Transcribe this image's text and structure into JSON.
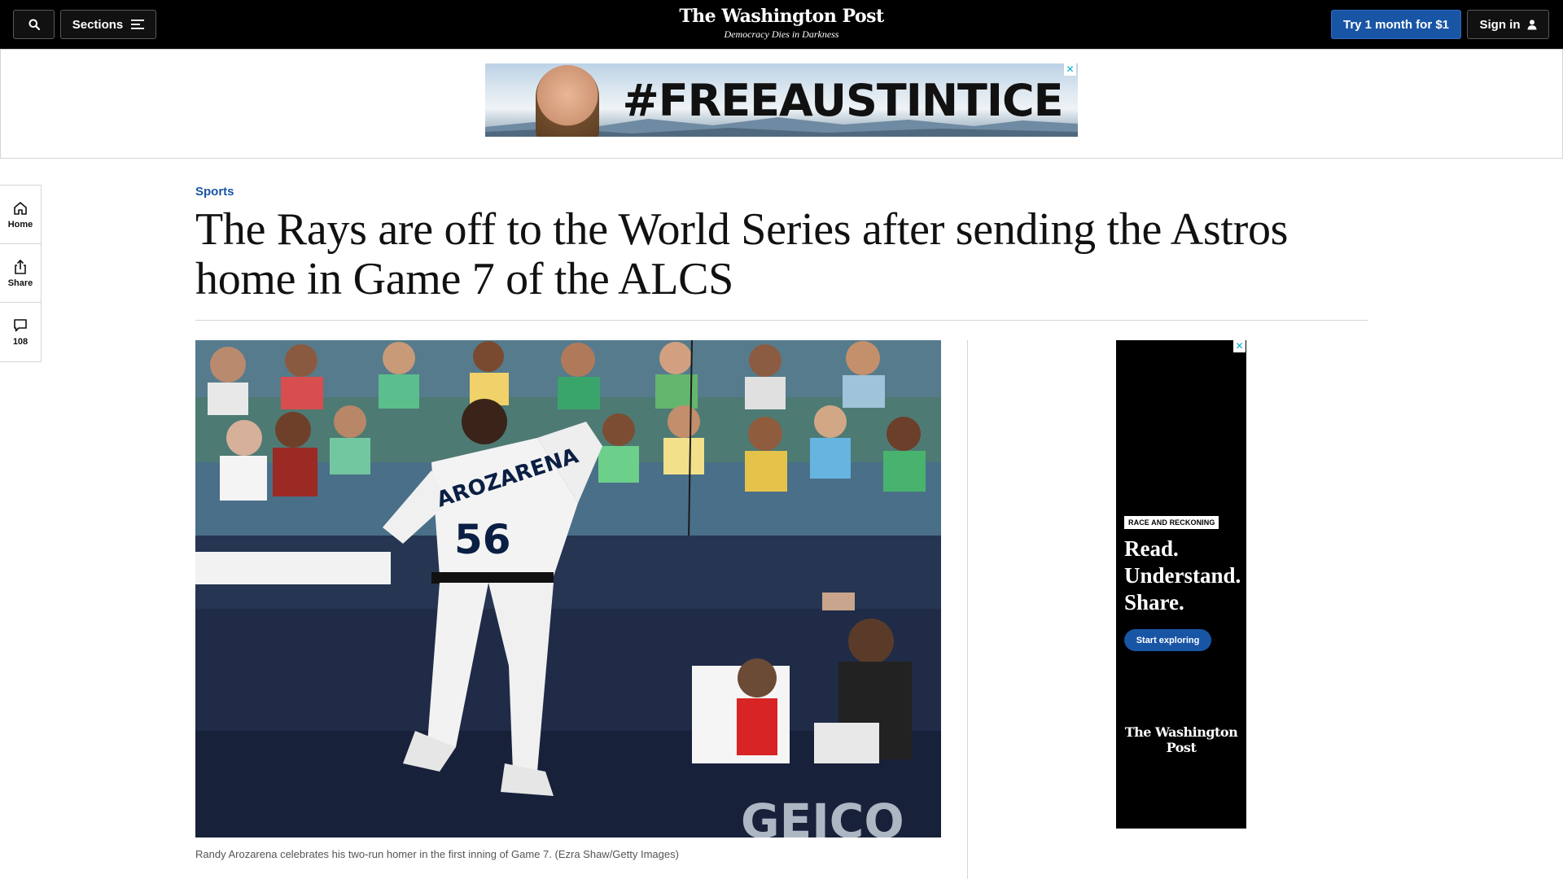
{
  "header": {
    "search_icon": "search-icon",
    "sections_label": "Sections",
    "logo": "The Washington Post",
    "tagline": "Democracy Dies in Darkness",
    "subscribe_label": "Try 1 month for $1",
    "signin_label": "Sign in"
  },
  "top_ad": {
    "hashtag": "#FREEAUSTINTICE",
    "close": "✕"
  },
  "rail": {
    "home_label": "Home",
    "share_label": "Share",
    "comments_count": "108"
  },
  "article": {
    "section": "Sports",
    "headline": "The Rays are off to the World Series after sending the Astros home in Game 7 of the ALCS",
    "caption": "Randy Arozarena celebrates his two-run homer in the first inning of Game 7. (Ezra Shaw/Getty Images)",
    "photo_text": {
      "jersey_name": "AROZARENA",
      "jersey_number": "56",
      "sponsor": "GEICO"
    }
  },
  "side_ad": {
    "close": "✕",
    "tag": "RACE AND RECKONING",
    "line1": "Read.",
    "line2": "Understand.",
    "line3": "Share.",
    "cta": "Start exploring",
    "logo": "The Washington Post"
  },
  "colors": {
    "accent": "#1955a5",
    "topbar": "#000000",
    "rule": "#d5d5d5"
  }
}
